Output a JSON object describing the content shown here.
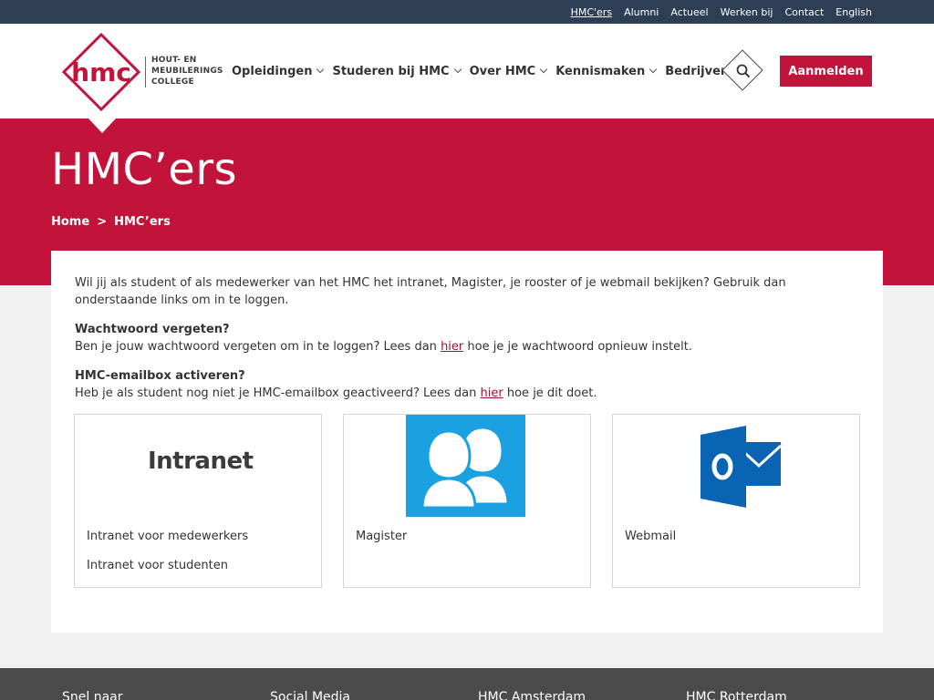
{
  "topbar": {
    "items": [
      {
        "label": "HMC'ers",
        "active": true
      },
      {
        "label": "Alumni"
      },
      {
        "label": "Actueel"
      },
      {
        "label": "Werken bij"
      },
      {
        "label": "Contact"
      },
      {
        "label": "English"
      }
    ]
  },
  "logo": {
    "mark": "hmc",
    "line1": "HOUT- EN",
    "line2": "MEUBILERINGS",
    "line3": "COLLEGE"
  },
  "nav": {
    "items": [
      {
        "label": "Opleidingen"
      },
      {
        "label": "Studeren bij HMC"
      },
      {
        "label": "Over HMC"
      },
      {
        "label": "Kennismaken"
      },
      {
        "label": "Bedrijven"
      }
    ],
    "login_label": "Aanmelden"
  },
  "hero": {
    "title": "HMC’ers",
    "breadcrumb": [
      "Home",
      ">",
      "HMC’ers"
    ]
  },
  "content": {
    "intro": "Wil jij als student of als medewerker van het HMC het intranet, Magister, je rooster of je webmail bekijken? Gebruik dan onderstaande links om in te loggen.",
    "password": {
      "title": "Wachtwoord vergeten?",
      "text_before": "Ben je jouw wachtwoord vergeten om in te loggen? Lees dan ",
      "link": "hier",
      "text_after": " hoe je je wachtwoord opnieuw instelt."
    },
    "email": {
      "title": "HMC-emailbox activeren?",
      "text_before": "Heb je als student nog niet je HMC-emailbox geactiveerd? Lees dan ",
      "link": "hier",
      "text_after": " hoe je dit doet."
    },
    "tiles": [
      {
        "logo_text": "Intranet",
        "links": [
          "Intranet voor medewerkers",
          "Intranet voor studenten"
        ]
      },
      {
        "links": [
          "Magister"
        ]
      },
      {
        "links": [
          "Webmail"
        ]
      }
    ]
  },
  "footer": {
    "columns": [
      "Snel naar",
      "Social Media",
      "HMC Amsterdam",
      "HMC Rotterdam"
    ]
  },
  "colors": {
    "brand_red": "#c2143a",
    "topbar": "#2e3e55",
    "magister_blue": "#1ba1e2",
    "outlook_blue": "#0a64b4"
  }
}
